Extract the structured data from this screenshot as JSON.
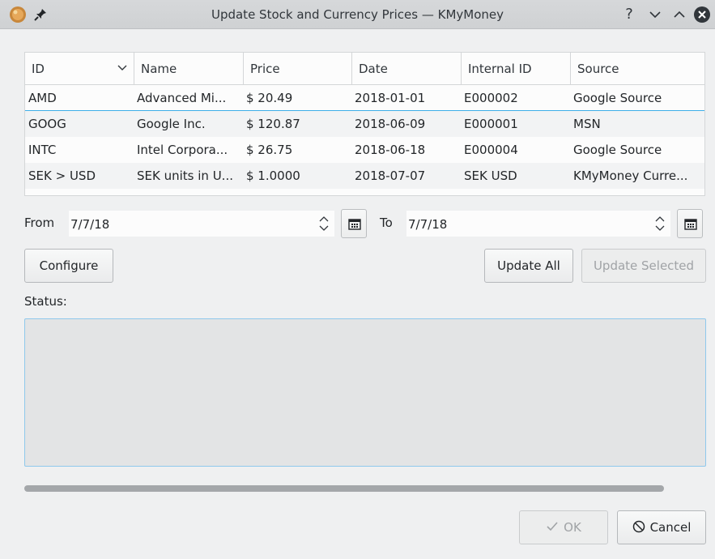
{
  "window": {
    "title": "Update Stock and Currency Prices — KMyMoney"
  },
  "titlebar": {
    "help_label": "?"
  },
  "table": {
    "columns": [
      "ID",
      "Name",
      "Price",
      "Date",
      "Internal ID",
      "Source"
    ],
    "rows": [
      [
        "AMD",
        "Advanced Mi...",
        "$ 20.49",
        "2018-01-01",
        "E000002",
        "Google Source"
      ],
      [
        "GOOG",
        "Google Inc.",
        "$ 120.87",
        "2018-06-09",
        "E000001",
        "MSN"
      ],
      [
        "INTC",
        "Intel Corpora...",
        "$ 26.75",
        "2018-06-18",
        "E000004",
        "Google Source"
      ],
      [
        "SEK > USD",
        "SEK units in U...",
        "$ 1.0000",
        "2018-07-07",
        "SEK USD",
        "KMyMoney Curre..."
      ]
    ]
  },
  "dates": {
    "from_label": "From",
    "from_value": "7/7/18",
    "to_label": "To",
    "to_value": "7/7/18"
  },
  "actions": {
    "configure_label": "Configure",
    "update_all_label": "Update All",
    "update_selected_label": "Update Selected"
  },
  "status": {
    "label": "Status:",
    "text": ""
  },
  "dialog": {
    "ok_label": "OK",
    "cancel_label": "Cancel"
  },
  "colors": {
    "accent": "#3daee9",
    "window_bg": "#eff0f1"
  }
}
